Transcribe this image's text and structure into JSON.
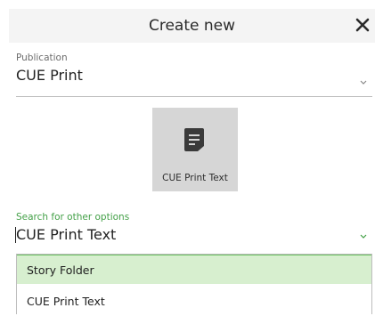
{
  "dialog": {
    "title": "Create new"
  },
  "publication": {
    "label": "Publication",
    "value": "CUE Print"
  },
  "content_tile": {
    "label": "CUE Print Text",
    "icon": "document-icon"
  },
  "search": {
    "label": "Search for other options",
    "value": "CUE Print Text"
  },
  "options": [
    {
      "label": "Story Folder"
    },
    {
      "label": "CUE Print Text"
    }
  ],
  "colors": {
    "header_bg": "#f4f4f4",
    "tile_bg": "#d6d6d6",
    "accent_green": "#43a047",
    "highlight_bg": "#d7efcf"
  }
}
